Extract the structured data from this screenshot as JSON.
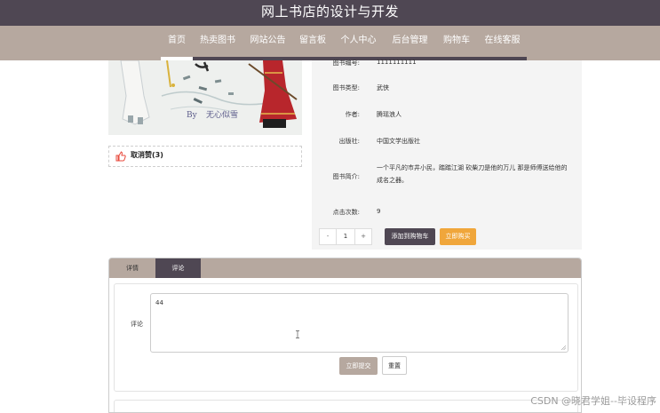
{
  "site_title": "网上书店的设计与开发",
  "nav": {
    "items": [
      {
        "label": "首页"
      },
      {
        "label": "热卖图书"
      },
      {
        "label": "网站公告"
      },
      {
        "label": "留言板"
      },
      {
        "label": "个人中心"
      },
      {
        "label": "后台管理"
      },
      {
        "label": "购物车"
      },
      {
        "label": "在线客服"
      }
    ],
    "active_index": 0
  },
  "book_image": {
    "caption_prefix": "By",
    "caption_author": "无心似雪"
  },
  "favorite": {
    "label": "取消赞(3)",
    "icon": "thumbs-up-icon",
    "icon_color": "#e84a3c"
  },
  "book_info": {
    "fields": [
      {
        "label": "图书编号:",
        "value": "1111111111"
      },
      {
        "label": "图书类型:",
        "value": "武侠"
      },
      {
        "label": "作者:",
        "value": "腾瑶浪人"
      },
      {
        "label": "出版社:",
        "value": "中国文学出版社"
      },
      {
        "label": "图书简介:",
        "value": "一个平凡的市井小民，踏踏江湖 砍柴刀是他的万儿 那是师傅送给他的成名之器。"
      },
      {
        "label": "点击次数:",
        "value": "9"
      }
    ]
  },
  "purchase": {
    "quantity": "1",
    "minus_label": "-",
    "plus_label": "+",
    "add_to_cart_label": "添加到购物车",
    "buy_now_label": "立即购买"
  },
  "tabs": [
    {
      "label": "详情"
    },
    {
      "label": "评论"
    }
  ],
  "comment": {
    "label": "评论",
    "value": "44",
    "submit_label": "立即提交",
    "reset_label": "重置"
  },
  "watermark": "CSDN @晓君学姐--毕设程序",
  "colors": {
    "header_bg": "#4f4753",
    "nav_bg": "#b6a89f",
    "buy_button": "#f0a63b",
    "cart_button": "#4f4753"
  }
}
